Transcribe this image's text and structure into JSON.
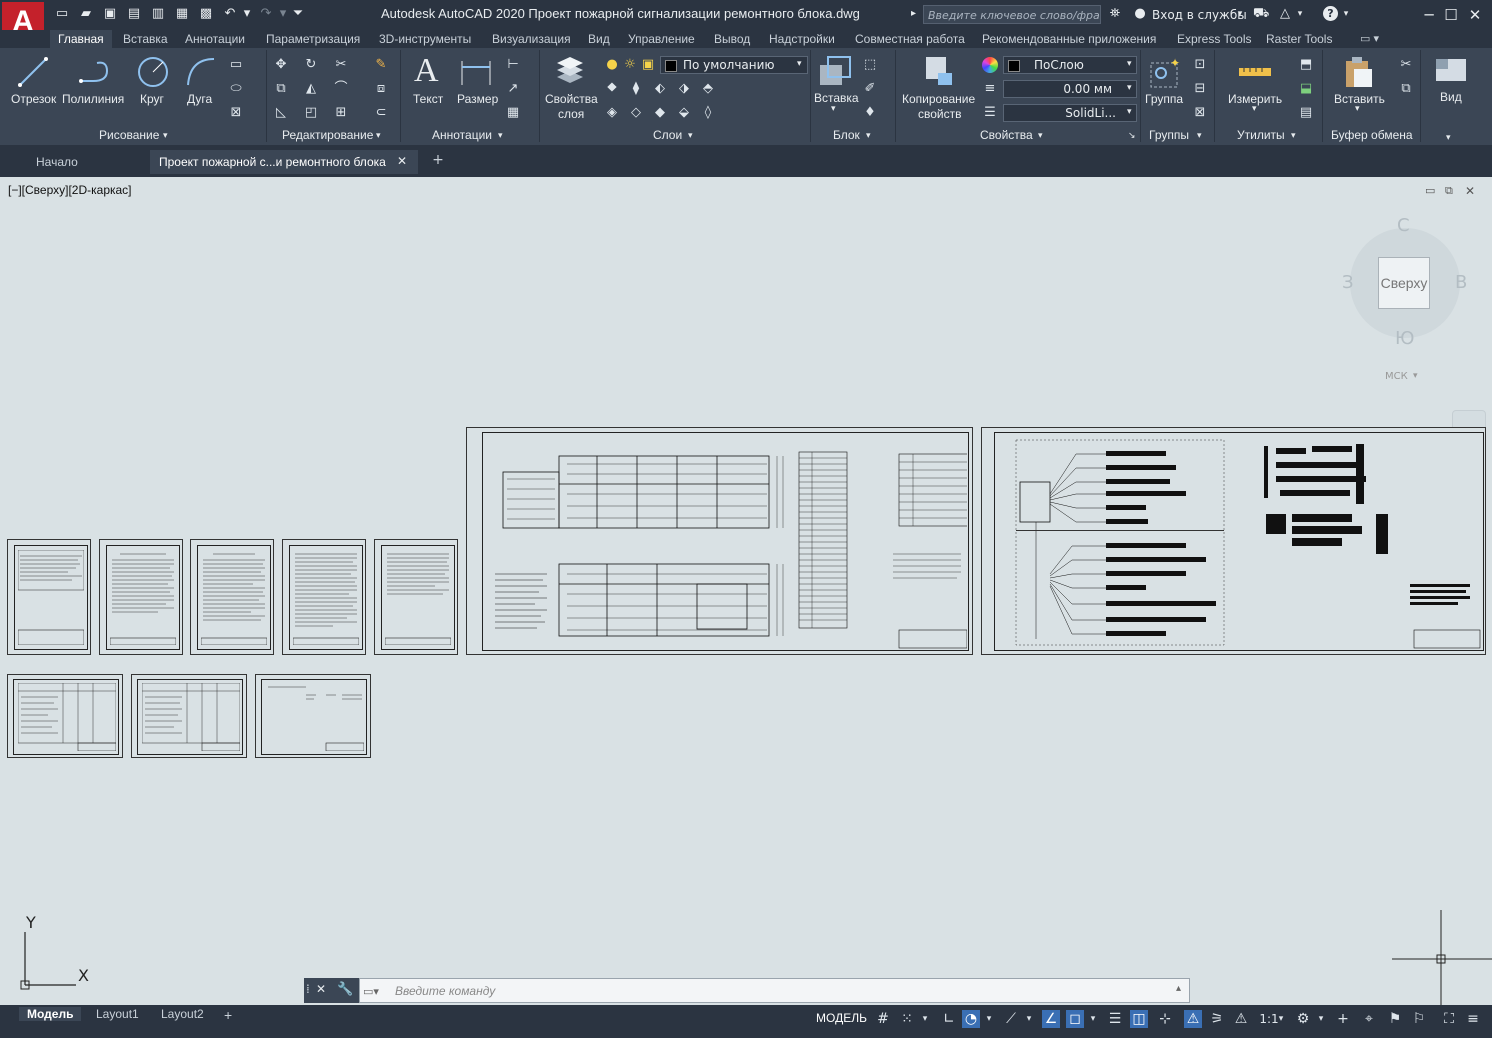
{
  "app": {
    "logo_letter": "A",
    "title": "Autodesk AutoCAD 2020   Проект пожарной сигнализации ремонтного блока.dwg",
    "search_placeholder": "Введите ключевое слово/фразу",
    "signin": "Вход в службы"
  },
  "ribbon_tabs": [
    "Главная",
    "Вставка",
    "Аннотации",
    "Параметризация",
    "3D-инструменты",
    "Визуализация",
    "Вид",
    "Управление",
    "Вывод",
    "Надстройки",
    "Совместная работа",
    "Рекомендованные приложения",
    "Express Tools",
    "Raster Tools"
  ],
  "draw_panel": {
    "title": "Рисование",
    "line": "Отрезок",
    "polyline": "Полилиния",
    "circle": "Круг",
    "arc": "Дуга"
  },
  "modify_panel": {
    "title": "Редактирование"
  },
  "annotation_panel": {
    "title": "Аннотации",
    "text": "Текст",
    "dimension": "Размер"
  },
  "layers_panel": {
    "title": "Слои",
    "layer_props_line1": "Свойства",
    "layer_props_line2": "слоя",
    "current_layer": "По умолчанию"
  },
  "block_panel": {
    "title": "Блок",
    "insert": "Вставка"
  },
  "properties_panel": {
    "title": "Свойства",
    "match_line1": "Копирование",
    "match_line2": "свойств",
    "color": "ПоСлою",
    "lineweight": "0.00 мм",
    "linetype": "SolidLi..."
  },
  "groups_panel": {
    "title": "Группы",
    "group": "Группа"
  },
  "utilities_panel": {
    "title": "Утилиты",
    "measure": "Измерить"
  },
  "clipboard_panel": {
    "title": "Буфер обмена",
    "paste": "Вставить"
  },
  "view_panel": {
    "title": "Вид"
  },
  "doc_tabs": {
    "start": "Начало",
    "file": "Проект пожарной с...и ремонтного блока"
  },
  "viewport": {
    "label": "[−][Сверху][2D-каркас]",
    "viewcube": {
      "face": "Сверху",
      "north": "С",
      "south": "Ю",
      "west": "З",
      "east": "В",
      "ucs": "МСК"
    },
    "ucs_y": "Y",
    "ucs_x": "X"
  },
  "command_line": {
    "placeholder": "Введите  команду"
  },
  "status": {
    "layout_tabs": [
      "Модель",
      "Layout1",
      "Layout2"
    ],
    "mode": "МОДЕЛЬ",
    "scale": "1:1"
  },
  "colors": {
    "chrome": "#2b3441",
    "ribbon": "#3b4655",
    "canvas": "#d9e1e4",
    "accent": "#3a6fb4",
    "logo": "#c4212b"
  }
}
